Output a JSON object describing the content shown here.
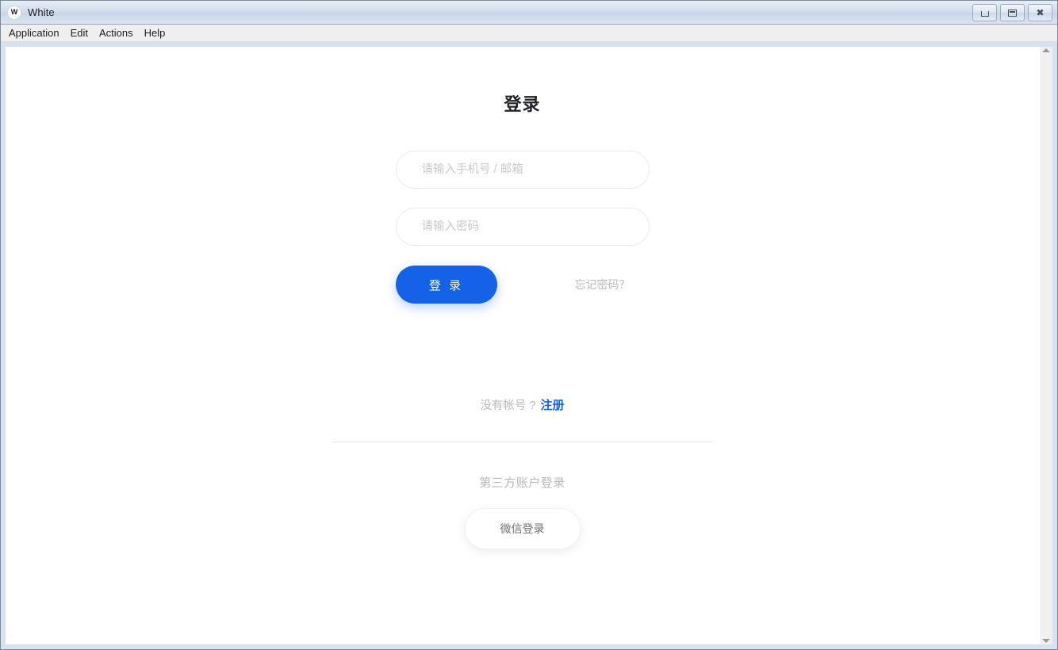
{
  "window": {
    "title": "White",
    "icon": "W",
    "controls": {
      "minimize": "minimize",
      "maximize": "maximize",
      "close": "✖"
    }
  },
  "menubar": {
    "items": [
      {
        "label": "Application"
      },
      {
        "label": "Edit"
      },
      {
        "label": "Actions"
      },
      {
        "label": "Help"
      }
    ]
  },
  "login": {
    "title": "登录",
    "username": {
      "placeholder": "请输入手机号 / 邮箱",
      "value": ""
    },
    "password": {
      "placeholder": "请输入密码",
      "value": ""
    },
    "submit_label": "登 录",
    "forgot_label": "忘记密码？",
    "signup_prompt": "没有帐号 ?",
    "signup_link": "注册",
    "third_party_label": "第三方账户登录",
    "wechat_label": "微信登录"
  },
  "colors": {
    "accent": "#1462e8",
    "muted_text": "#b6bac0",
    "title_text": "#20232a",
    "field_border": "#e9eaec",
    "divider": "#e8e8e8",
    "window_frame": "#d6e2f0"
  },
  "scrollbar": {
    "up_arrow": "scroll-up",
    "down_arrow": "scroll-down"
  }
}
